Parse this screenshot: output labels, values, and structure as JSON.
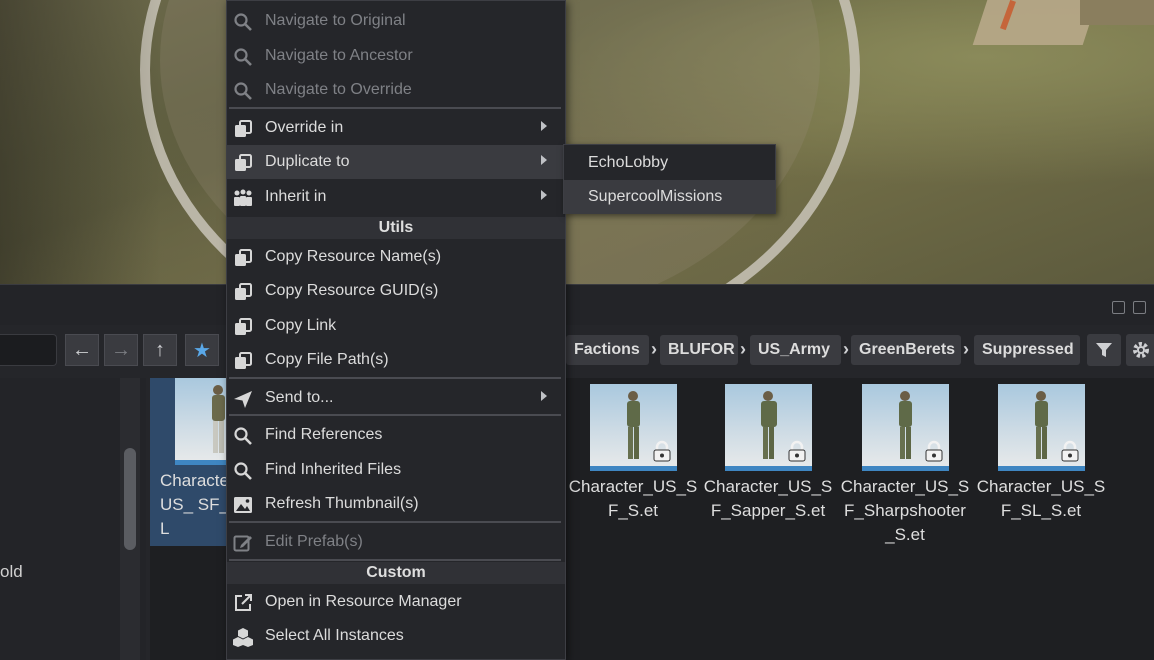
{
  "context_menu": {
    "items": [
      {
        "label": "Navigate to Original",
        "icon": "search-icon",
        "disabled": true
      },
      {
        "label": "Navigate to Ancestor",
        "icon": "search-icon",
        "disabled": true
      },
      {
        "label": "Navigate to Override",
        "icon": "search-icon",
        "disabled": true
      },
      {
        "label": "Override in",
        "icon": "copy-icon",
        "submenu": true
      },
      {
        "label": "Duplicate to",
        "icon": "copy-icon",
        "submenu": true,
        "hover": true
      },
      {
        "label": "Inherit in",
        "icon": "inherit-icon",
        "submenu": true
      },
      {
        "label": "Copy Resource Name(s)",
        "icon": "copy-icon"
      },
      {
        "label": "Copy Resource GUID(s)",
        "icon": "copy-icon"
      },
      {
        "label": "Copy Link",
        "icon": "copy-icon"
      },
      {
        "label": "Copy File Path(s)",
        "icon": "copy-icon"
      },
      {
        "label": "Send to...",
        "icon": "send-icon",
        "submenu": true
      },
      {
        "label": "Find References",
        "icon": "search-icon"
      },
      {
        "label": "Find Inherited Files",
        "icon": "search-icon"
      },
      {
        "label": "Refresh Thumbnail(s)",
        "icon": "image-icon"
      },
      {
        "label": "Edit Prefab(s)",
        "icon": "edit-icon",
        "disabled": true
      },
      {
        "label": "Open in Resource Manager",
        "icon": "external-link-icon"
      },
      {
        "label": "Select All Instances",
        "icon": "cubes-icon"
      }
    ],
    "sections": {
      "utils": "Utils",
      "custom": "Custom"
    }
  },
  "submenu": {
    "items": [
      {
        "label": "EchoLobby"
      },
      {
        "label": "SupercoolMissions",
        "hover": true
      }
    ]
  },
  "breadcrumbs": [
    "Factions",
    "BLUFOR",
    "US_Army",
    "GreenBerets",
    "Suppressed"
  ],
  "nav": {
    "back": "←",
    "forward": "→",
    "up": "↑",
    "favorite": "★"
  },
  "sidebar": {
    "partial_text": "old"
  },
  "assets": [
    {
      "name": "Character_US_SF_GL_S.et",
      "visible_name": "Characte r_US_ SF_GL",
      "selected": true,
      "locked": false
    },
    {
      "name": "Character_US_SF_S.et",
      "locked": true
    },
    {
      "name": "Character_US_SF_Sapper_S.et",
      "locked": true
    },
    {
      "name": "Character_US_SF_Sharpshooter_S.et",
      "locked": true
    },
    {
      "name": "Character_US_SF_SL_S.et",
      "locked": true
    }
  ],
  "colors": {
    "accent": "#3f86c2",
    "selection": "#2f4a6a",
    "favorite": "#5aa8e8"
  }
}
